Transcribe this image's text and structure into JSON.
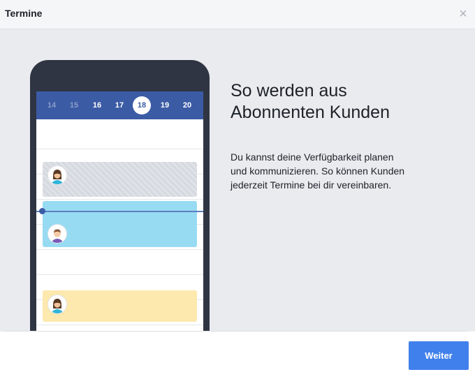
{
  "header": {
    "title": "Termine",
    "close_glyph": "×"
  },
  "calendar": {
    "dates": [
      "14",
      "15",
      "16",
      "17",
      "18",
      "19",
      "20"
    ],
    "selected": "18"
  },
  "headline_lines": [
    "So werden aus",
    "Abonnenten Kunden"
  ],
  "body_lines": [
    "Du kannst deine Verfügbarkeit planen",
    "und kommunizieren. So können Kunden",
    "jederzeit Termine bei dir vereinbaren."
  ],
  "footer": {
    "next_label": "Weiter"
  },
  "colors": {
    "accent": "#4080ec",
    "calendar_bar": "#3b5ba5",
    "event_blue": "#97dbf2",
    "event_yellow": "#fde8ae",
    "event_grey": "#d8dce1",
    "phone_body": "#2f3542"
  },
  "icons": [
    "close-icon",
    "avatar-woman-icon",
    "avatar-man-icon"
  ]
}
